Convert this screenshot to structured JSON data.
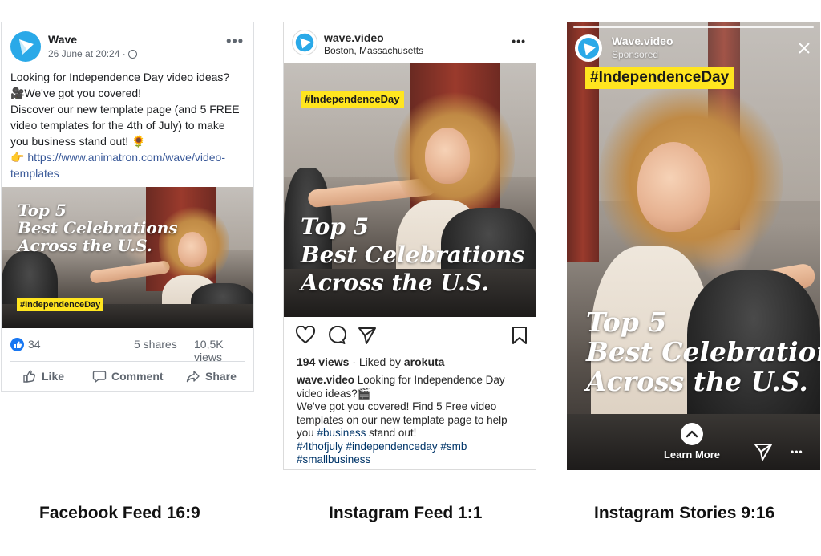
{
  "facebook": {
    "page_name": "Wave",
    "timestamp": "26 June at 20:24 · ",
    "globe_icon": "globe-icon",
    "post_lines": [
      "Looking for Independence Day video ideas?",
      "🎥We've got you covered!",
      "Discover our new template page (and 5 FREE",
      "video templates for the 4th of July) to make",
      "you business stand out! 🌻"
    ],
    "link_prefix": "👉 ",
    "link_line1": "https://www.animatron.com/wave/video-",
    "link_line2": "templates",
    "image": {
      "title_line1": "Top 5",
      "title_line2": "Best Celebrations",
      "title_line3": "Across the U.S.",
      "hashtag": "#IndependenceDay"
    },
    "likes": "34",
    "shares": "5 shares",
    "views": "10,5K views",
    "like_label": "Like",
    "comment_label": "Comment",
    "share_label": "Share",
    "accent": "#385898"
  },
  "instagram": {
    "account": "wave.video",
    "location": "Boston, Massachusetts",
    "image": {
      "title_line1": "Top 5",
      "title_line2": "Best Celebrations",
      "title_line3": "Across the U.S.",
      "hashtag": "#IndependenceDay"
    },
    "views_count": "194 views",
    "liked_by_prefix": " · Liked by ",
    "liked_by_user": "arokuta",
    "caption_user": "wave.video",
    "caption_line1": " Looking for Independence Day",
    "caption_line2": "video ideas?🎬",
    "caption_line3": "We've got you covered! Find 5 Free video",
    "caption_line4": "templates on our new template page to help",
    "caption_line5_pre": "you ",
    "caption_line5_tag": "#business",
    "caption_line5_post": " stand out!",
    "hashtags_line1": "#4thofjuly #independenceday #smb",
    "hashtags_line2": "#smallbusiness"
  },
  "stories": {
    "account": "Wave.video",
    "sponsored": "Sponsored",
    "image": {
      "title_line1": "Top 5",
      "title_line2": "Best Celebrations",
      "title_line3": "Across the U.S.",
      "hashtag": "#IndependenceDay"
    },
    "learn_more": "Learn More"
  },
  "labels": {
    "facebook": "Facebook Feed 16:9",
    "instagram_feed": "Instagram Feed 1:1",
    "instagram_stories": "Instagram Stories 9:16"
  },
  "colors": {
    "brand_blue": "#2aa9e8",
    "hashtag_yellow": "#ffe51f",
    "facebook_like_blue": "#1877f2"
  }
}
